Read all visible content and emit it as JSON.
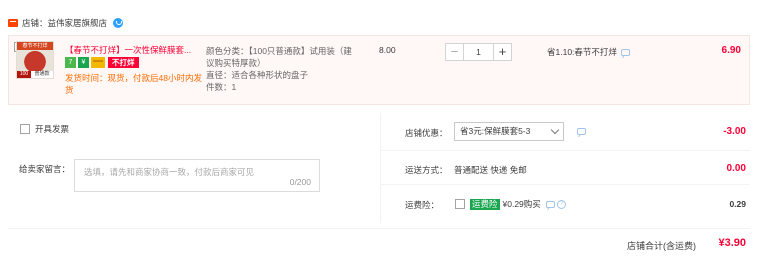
{
  "shop": {
    "label": "店铺：",
    "name": "益伟家居旗舰店"
  },
  "item": {
    "thumb_top": "春节不打烊",
    "thumb_left": "100",
    "thumb_right": "普通款",
    "title": "【春节不打烊】一次性保鲜膜套...",
    "badge_7": "7",
    "badge_g": "¥",
    "no_ship_badge": "不打烊",
    "ship_time": "发货时间：现货，付款后48小时内发货",
    "sku_color": "颜色分类：【100只普通款】试用装（建议购买特厚款）",
    "sku_size": "直径：适合各种形状的盘子",
    "sku_pieces": "件数：1",
    "unit_price": "8.00",
    "qty_minus": "−",
    "qty_value": "1",
    "qty_plus": "+",
    "savings": "省1.10:春节不打烊",
    "total": "6.90"
  },
  "invoice": {
    "label": "开具发票"
  },
  "message": {
    "label": "给卖家留言：",
    "placeholder": "选填，请先和商家协商一致，付款后商家可见",
    "count": "0/200"
  },
  "discount": {
    "label": "店铺优惠：",
    "select_value": "省3元:保鲜膜套5-3",
    "value": "-3.00"
  },
  "shipping": {
    "label": "运送方式：",
    "option": "普通配送 快递 免邮",
    "value": "0.00"
  },
  "insurance": {
    "label": "运费险：",
    "tag": "运费险",
    "price": "¥0.29购买",
    "help": "?",
    "value": "0.29"
  },
  "footer": {
    "label": "店铺合计(含运费)",
    "value": "¥3.90"
  }
}
